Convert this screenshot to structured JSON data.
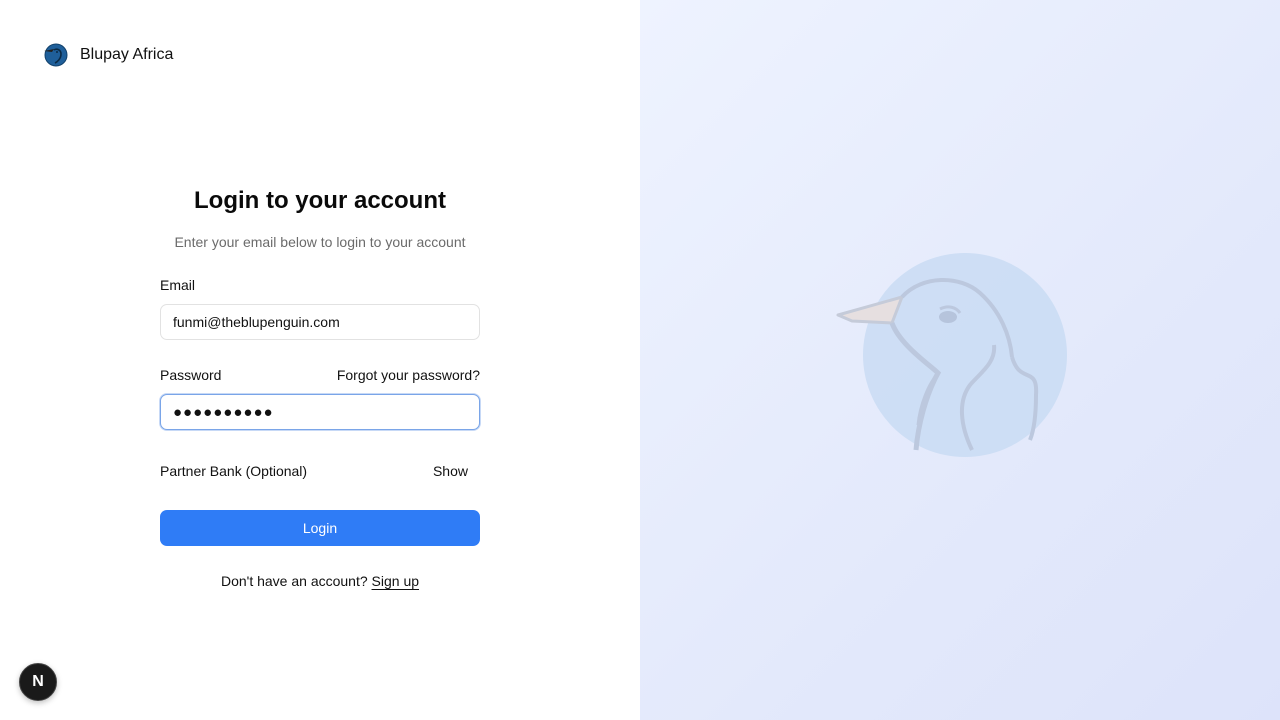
{
  "brand": {
    "name": "Blupay Africa",
    "logo_icon": "penguin-logo-icon"
  },
  "form": {
    "title": "Login to your account",
    "subtitle": "Enter your email below to login to your account",
    "email": {
      "label": "Email",
      "value": "funmi@theblupenguin.com"
    },
    "password": {
      "label": "Password",
      "forgot_label": "Forgot your password?",
      "masked_value": "●●●●●●●●●●"
    },
    "partner_bank": {
      "label": "Partner Bank (Optional)",
      "toggle_label": "Show"
    },
    "login_label": "Login",
    "signup_prompt": "Don't have an account?",
    "signup_label": "Sign up"
  },
  "dev_badge": {
    "label": "N",
    "icon": "nextjs-icon"
  },
  "hero": {
    "icon": "penguin-illustration-icon"
  },
  "colors": {
    "accent": "#2f7cf6",
    "panel_bg": "#e8edfc",
    "focus_ring": "#7aa5e8"
  }
}
